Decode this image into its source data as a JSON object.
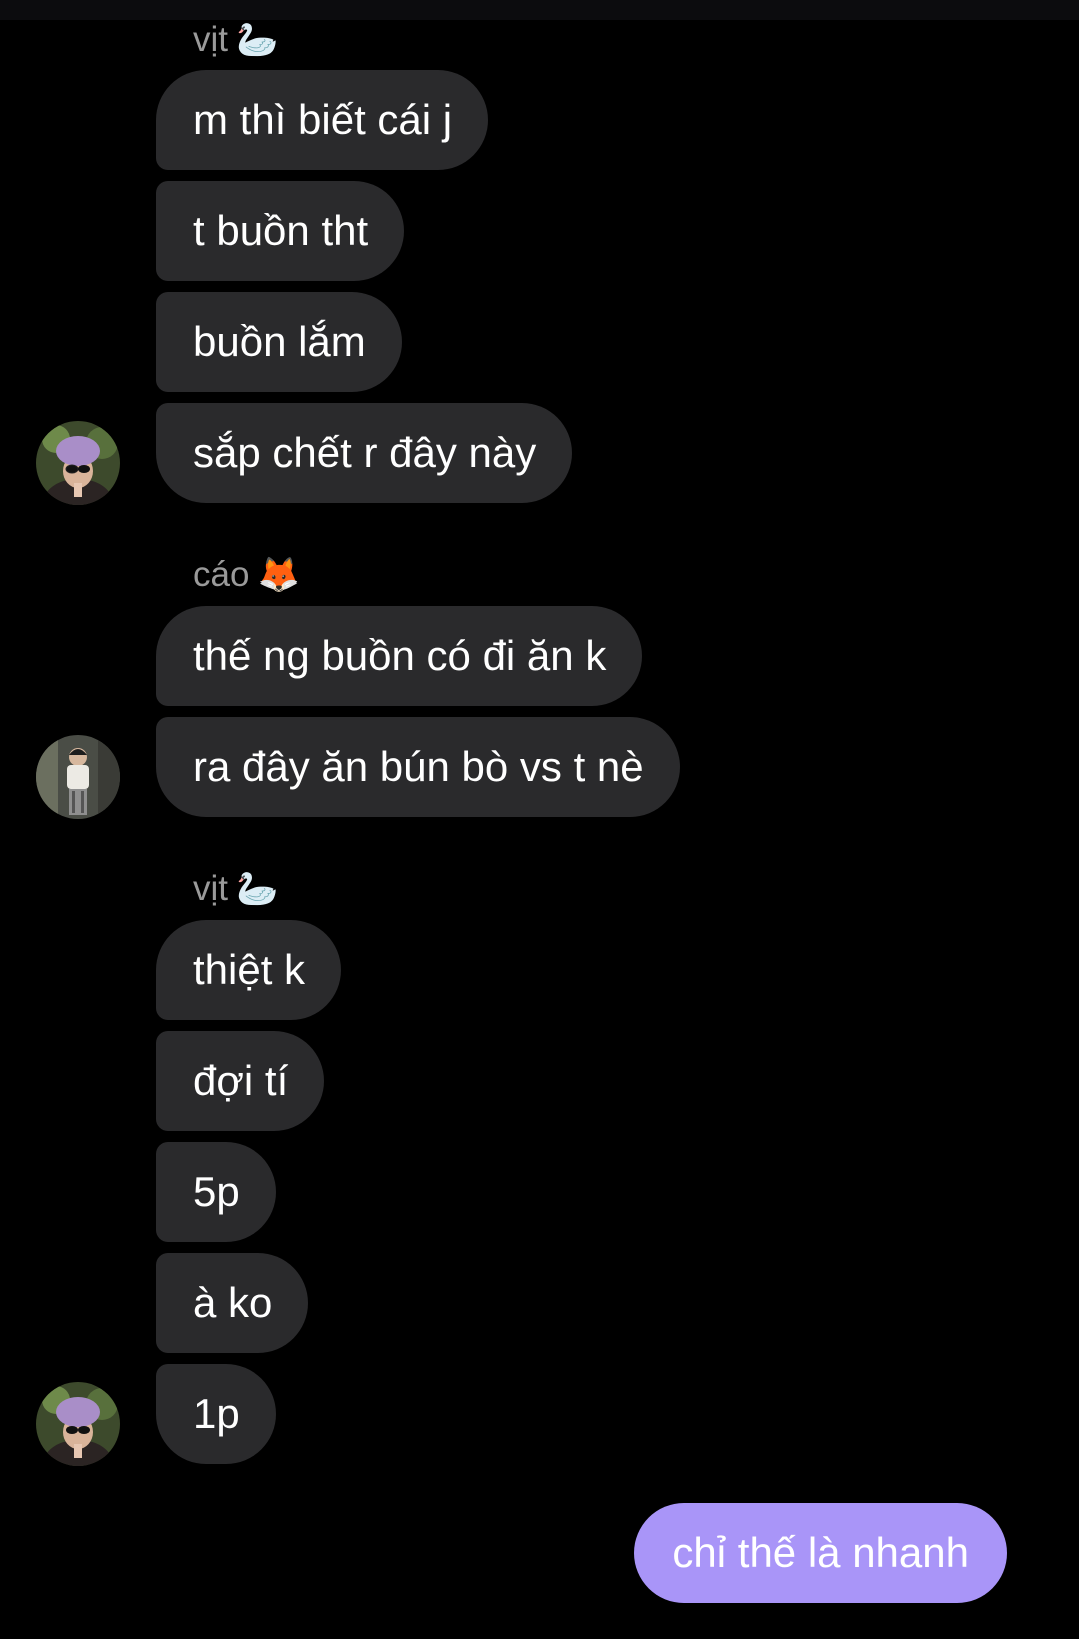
{
  "groups": [
    {
      "sender": {
        "name": "vịt",
        "emoji": "🦢"
      },
      "messages": [
        "m thì biết cái j",
        "t buồn tht",
        "buồn lắm",
        "sắp chết r đây này"
      ]
    },
    {
      "sender": {
        "name": "cáo",
        "emoji": "🦊"
      },
      "messages": [
        "thế ng buồn có đi ăn k",
        "ra đây ăn bún bò vs t nè"
      ]
    },
    {
      "sender": {
        "name": "vịt",
        "emoji": "🦢"
      },
      "messages": [
        "thiệt k",
        "đợi tí",
        "5p",
        "à ko",
        "1p"
      ]
    }
  ],
  "my_message": "chỉ thế là nhanh",
  "colors": {
    "background": "#000000",
    "incoming_bubble": "#2a2a2c",
    "outgoing_bubble": "#a995f8",
    "sender_name": "#9a9a9a",
    "text": "#ffffff"
  }
}
